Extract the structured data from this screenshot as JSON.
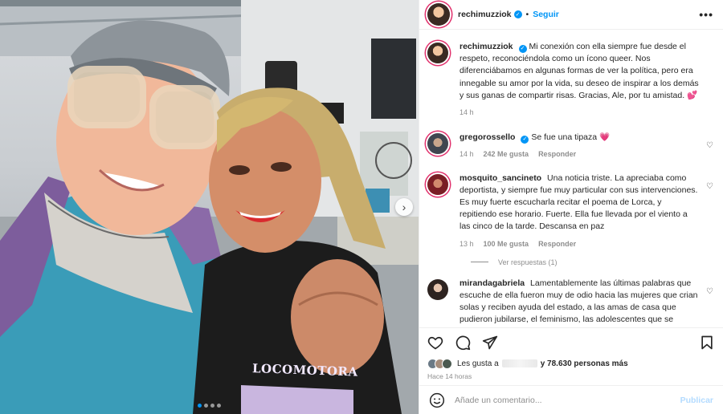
{
  "post": {
    "author": "rechimuzziok",
    "follow_label": "Seguir",
    "separator": "•",
    "more_label": "•••",
    "caption": {
      "user": "rechimuzziok",
      "text": "Mi conexión con ella siempre fue desde el respeto, reconociéndola como un ícono queer. Nos diferenciábamos en algunas formas de ver la política, pero era innegable su amor por la vida, su deseo de inspirar a los demás y sus ganas de compartir risas. Gracias, Ale, por tu amistad. 💕",
      "time": "14 h"
    },
    "shirt_text": "LOCOMOTORA",
    "carousel": {
      "count": 4,
      "active": 0
    }
  },
  "comments": [
    {
      "user": "gregorossello",
      "verified": true,
      "text": "Se fue una tipaza 💗",
      "time": "14 h",
      "likes": "242 Me gusta",
      "reply_label": "Responder"
    },
    {
      "user": "mosquito_sancineto",
      "verified": false,
      "text": "Una noticia triste. La apreciaba como deportista, y siempre fue muy particular con sus intervenciones. Es muy fuerte escucharla recitar el poema de Lorca, y repitiendo ese horario. Fuerte. Ella fue llevada por el viento a las cinco de la tarde. Descansa en paz",
      "time": "13 h",
      "likes": "100 Me gusta",
      "reply_label": "Responder",
      "view_replies": "Ver respuestas (1)"
    },
    {
      "user": "mirandagabriela",
      "verified": false,
      "text": "Lamentablemente las últimas palabras que escuche de ella fueron muy de odio hacia las mujeres que crian solas y reciben ayuda del estado, a las amas de casa que pudieron jubilarse, el feminismo, las adolescentes que se"
    }
  ],
  "likes": {
    "prefix": "Les gusta a",
    "suffix": "y 78.630 personas más"
  },
  "posted_ago": "Hace 14 horas",
  "comment_box": {
    "placeholder": "Añade un comentario...",
    "publish_label": "Publicar"
  },
  "icons": [
    "heart-icon",
    "comment-icon",
    "share-icon",
    "bookmark-icon",
    "emoji-icon",
    "verified-icon",
    "chevron-right-icon",
    "more-icon"
  ]
}
